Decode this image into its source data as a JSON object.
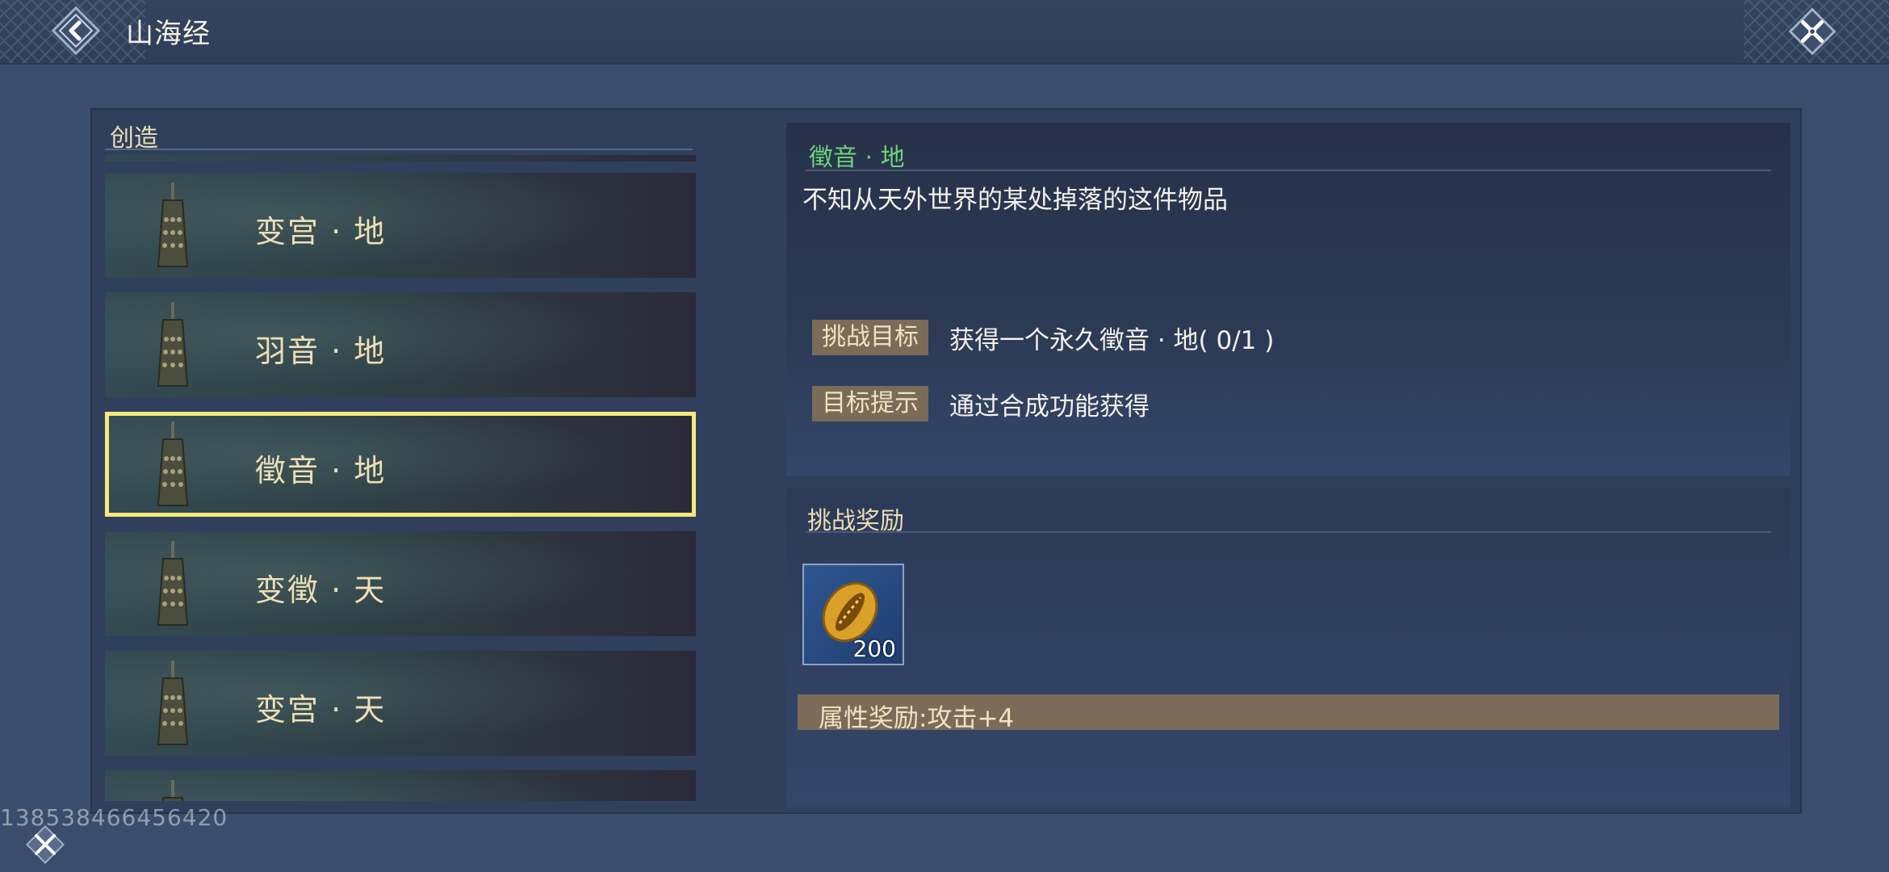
{
  "header": {
    "title": "山海经",
    "back_icon": "back-arrow-icon",
    "close_icon": "close-icon"
  },
  "left_panel": {
    "section_title": "创造",
    "items": [
      {
        "label": "变宫 · 地",
        "icon": "bell-icon",
        "selected": false
      },
      {
        "label": "羽音 · 地",
        "icon": "bell-icon",
        "selected": false
      },
      {
        "label": "徵音 · 地",
        "icon": "bell-icon",
        "selected": true
      },
      {
        "label": "变徵 · 天",
        "icon": "bell-icon",
        "selected": false
      },
      {
        "label": "变宫 · 天",
        "icon": "bell-icon",
        "selected": false
      }
    ]
  },
  "detail": {
    "item_name": "徵音 · 地",
    "description": "不知从天外世界的某处掉落的这件物品",
    "goal_tag": "挑战目标",
    "goal_text": "获得一个永久徵音 · 地( 0/1 )",
    "hint_tag": "目标提示",
    "hint_text": "通过合成功能获得"
  },
  "rewards": {
    "title": "挑战奖励",
    "item_icon": "shell-currency-icon",
    "item_count": "200",
    "attribute_reward": "属性奖励:攻击+4"
  },
  "footer": {
    "uid": "138538466456420",
    "corner_icon": "crossed-swords-icon"
  },
  "colors": {
    "selected_border": "#f3ea7a",
    "item_name": "#6fd37a",
    "tag_bg": "#7a6c58",
    "list_label": "#eedfb6"
  }
}
